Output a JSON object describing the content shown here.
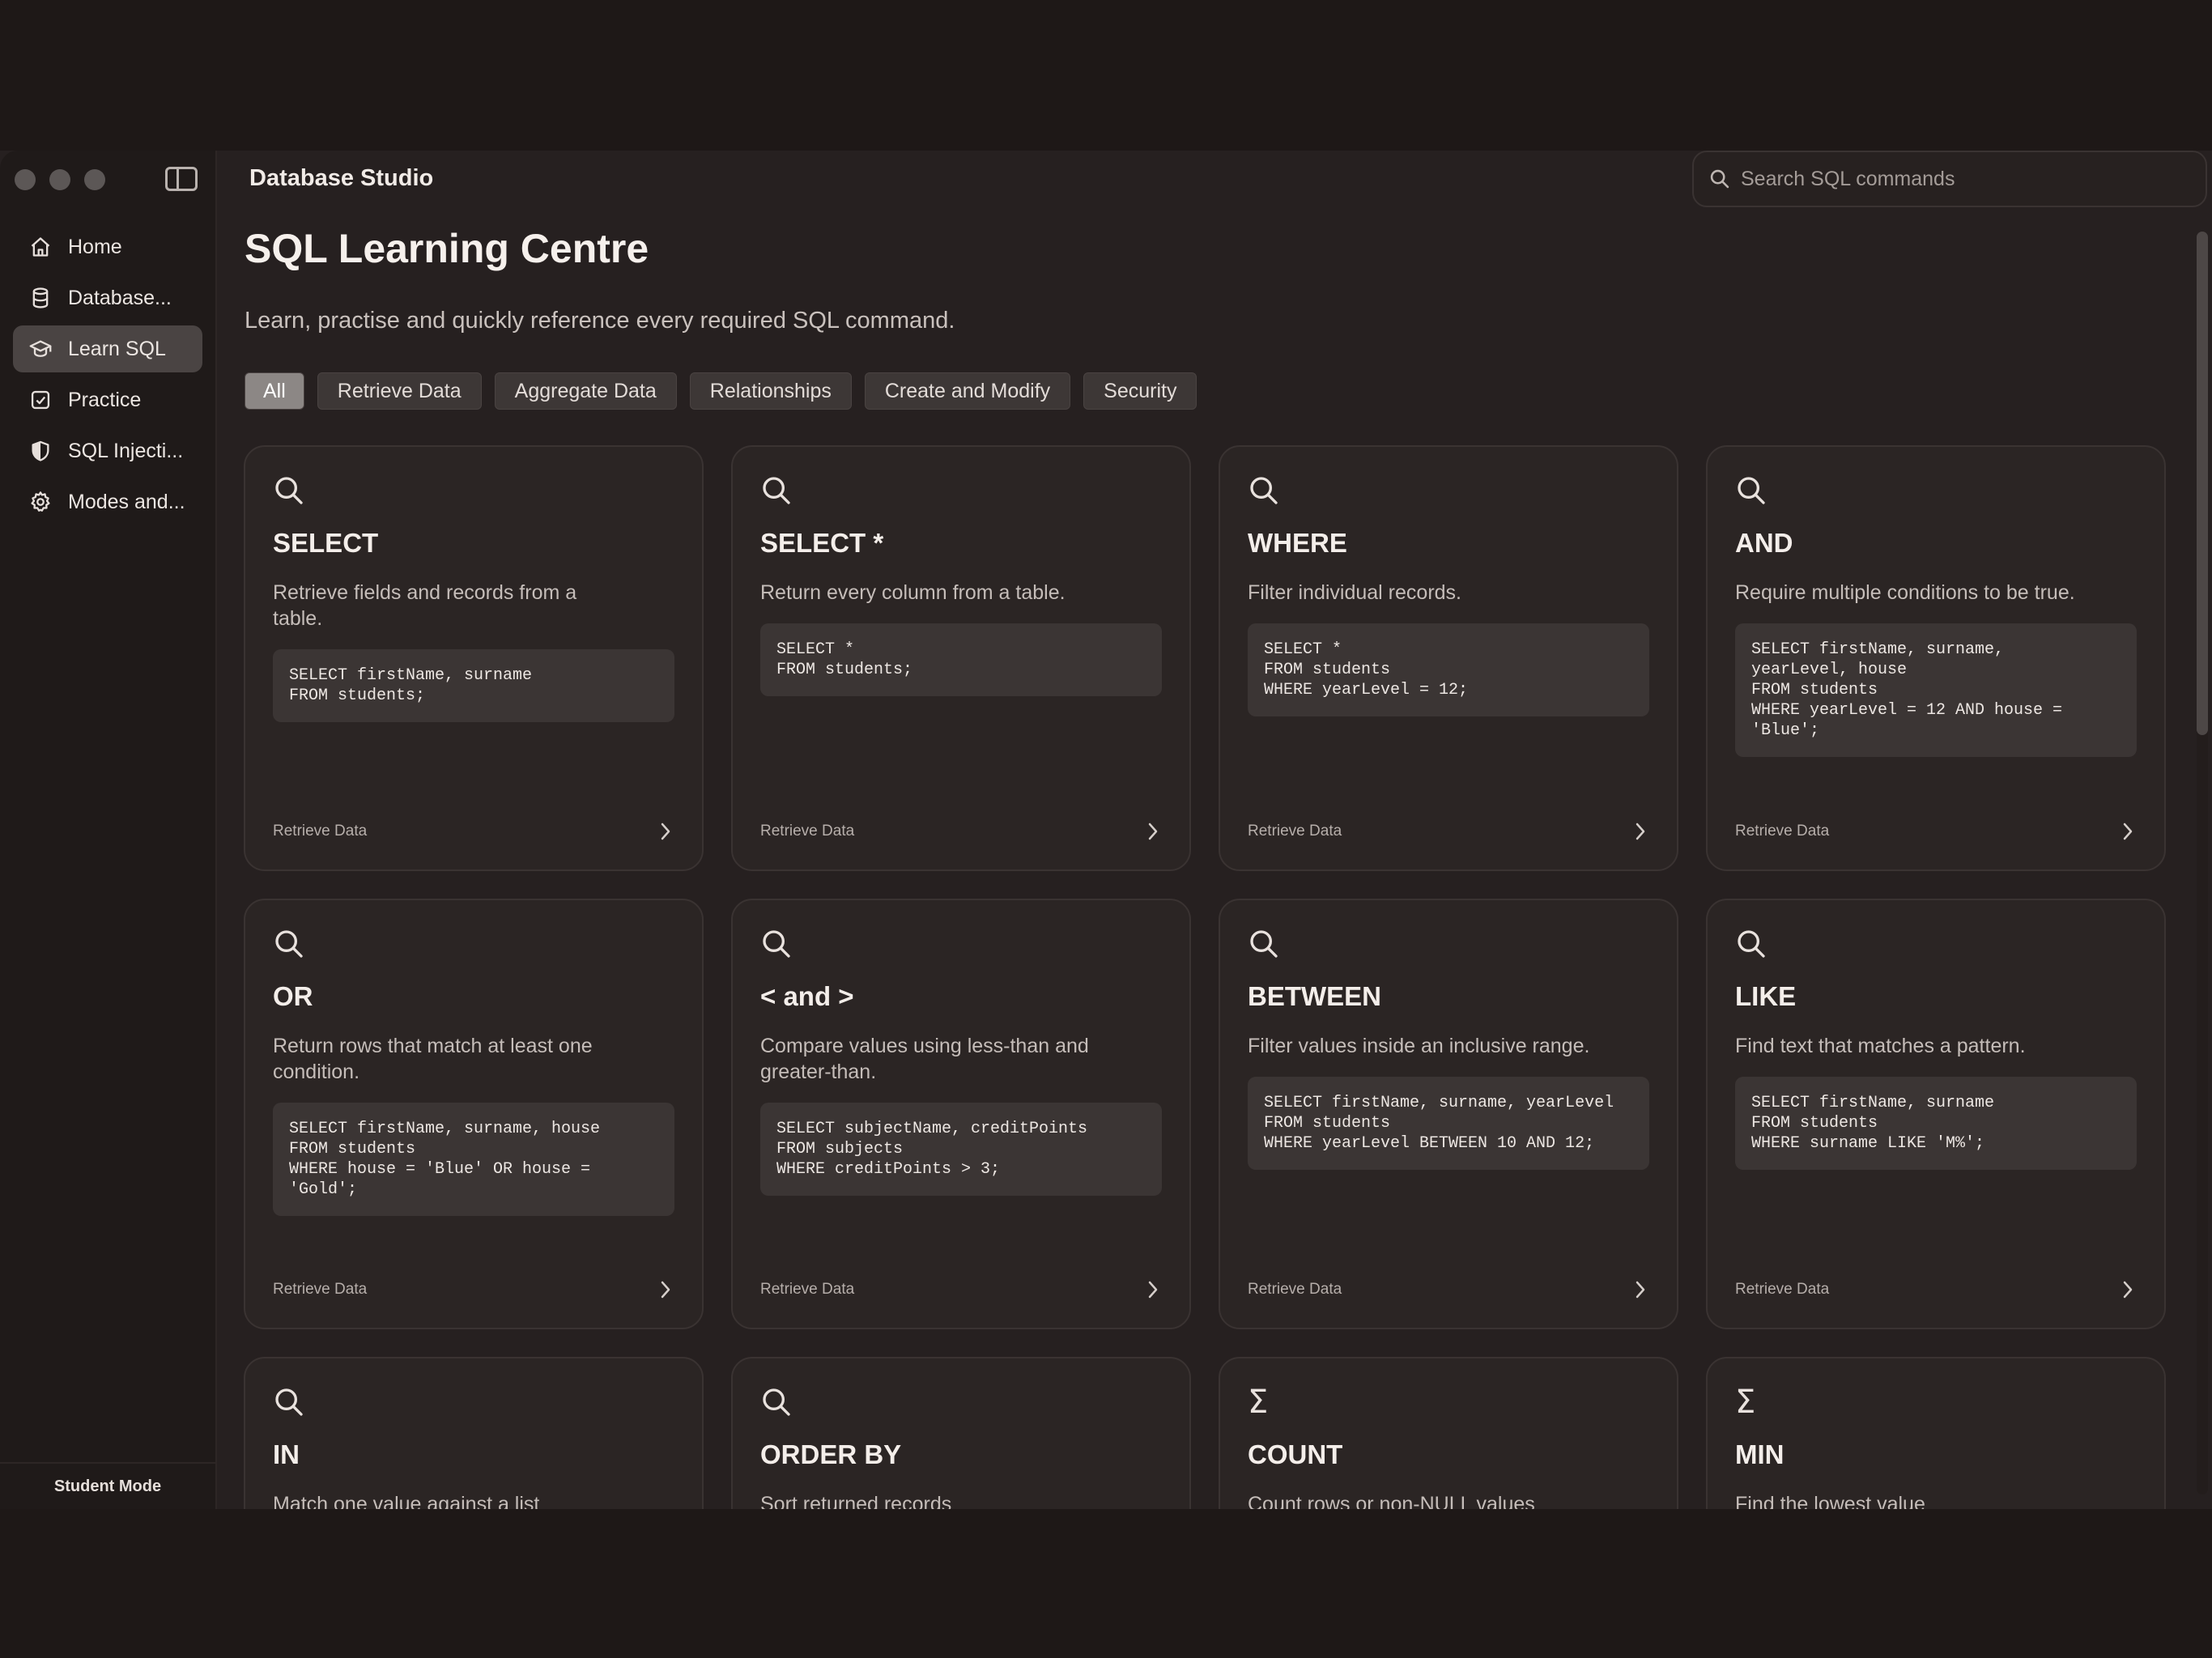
{
  "app": {
    "title": "Database Studio"
  },
  "search": {
    "placeholder": "Search SQL commands"
  },
  "sidebar": {
    "items": [
      {
        "label": "Home",
        "icon": "home-icon"
      },
      {
        "label": "Database...",
        "icon": "database-icon"
      },
      {
        "label": "Learn SQL",
        "icon": "graduation-cap-icon",
        "active": true
      },
      {
        "label": "Practice",
        "icon": "checkbox-icon"
      },
      {
        "label": "SQL Injecti...",
        "icon": "shield-icon"
      },
      {
        "label": "Modes and...",
        "icon": "gear-icon"
      }
    ],
    "footer": "Student Mode"
  },
  "page": {
    "title": "SQL Learning Centre",
    "subtitle": "Learn, practise and quickly reference every required SQL command."
  },
  "filters": [
    "All",
    "Retrieve Data",
    "Aggregate Data",
    "Relationships",
    "Create and Modify",
    "Security"
  ],
  "cards": [
    {
      "title": "SELECT",
      "desc": "Retrieve fields and records from a table.",
      "code": "SELECT firstName, surname\nFROM students;",
      "category": "Retrieve Data",
      "icon": "search-icon"
    },
    {
      "title": "SELECT *",
      "desc": "Return every column from a table.",
      "code": "SELECT *\nFROM students;",
      "category": "Retrieve Data",
      "icon": "search-icon"
    },
    {
      "title": "WHERE",
      "desc": "Filter individual records.",
      "code": "SELECT *\nFROM students\nWHERE yearLevel = 12;",
      "category": "Retrieve Data",
      "icon": "search-icon"
    },
    {
      "title": "AND",
      "desc": "Require multiple conditions to be true.",
      "code": "SELECT firstName, surname,\nyearLevel, house\nFROM students\nWHERE yearLevel = 12 AND house =\n'Blue';",
      "category": "Retrieve Data",
      "icon": "search-icon"
    },
    {
      "title": "OR",
      "desc": "Return rows that match at least one condition.",
      "code": "SELECT firstName, surname, house\nFROM students\nWHERE house = 'Blue' OR house =\n'Gold';",
      "category": "Retrieve Data",
      "icon": "search-icon"
    },
    {
      "title": "< and >",
      "desc": "Compare values using less-than and greater-than.",
      "code": "SELECT subjectName, creditPoints\nFROM subjects\nWHERE creditPoints > 3;",
      "category": "Retrieve Data",
      "icon": "search-icon"
    },
    {
      "title": "BETWEEN",
      "desc": "Filter values inside an inclusive range.",
      "code": "SELECT firstName, surname, yearLevel\nFROM students\nWHERE yearLevel BETWEEN 10 AND 12;",
      "category": "Retrieve Data",
      "icon": "search-icon"
    },
    {
      "title": "LIKE",
      "desc": "Find text that matches a pattern.",
      "code": "SELECT firstName, surname\nFROM students\nWHERE surname LIKE 'M%';",
      "category": "Retrieve Data",
      "icon": "search-icon"
    },
    {
      "title": "IN",
      "desc": "Match one value against a list",
      "icon": "search-icon"
    },
    {
      "title": "ORDER BY",
      "desc": "Sort returned records",
      "icon": "search-icon"
    },
    {
      "title": "COUNT",
      "desc": "Count rows or non-NULL values",
      "icon": "sigma-icon"
    },
    {
      "title": "MIN",
      "desc": "Find the lowest value",
      "icon": "sigma-icon"
    }
  ]
}
